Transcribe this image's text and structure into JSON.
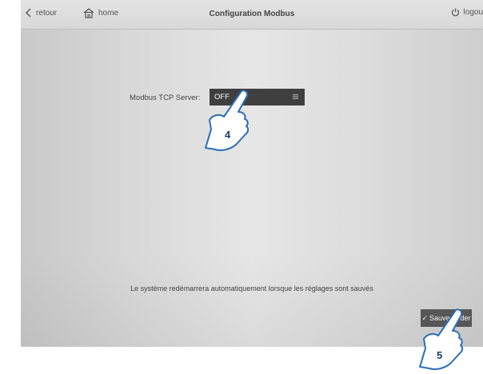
{
  "header": {
    "back_label": "retour",
    "home_label": "home",
    "title": "Configuration Modbus",
    "logout_label": "logou"
  },
  "form": {
    "modbus_tcp_label": "Modbus TCP Server:",
    "modbus_tcp_value": "OFF"
  },
  "message": "Le système redémarrera automatiquement lorsque les réglages sont sauvés",
  "save_button": {
    "label": "Sauvegarder",
    "icon": "checkmark-icon"
  },
  "callouts": [
    "4",
    "5"
  ],
  "colors": {
    "select_bg": "#3f3f3f",
    "button_bg": "#5a5a5a",
    "callout_outline": "#2b6fb6",
    "callout_number": "#1b3c6b"
  }
}
